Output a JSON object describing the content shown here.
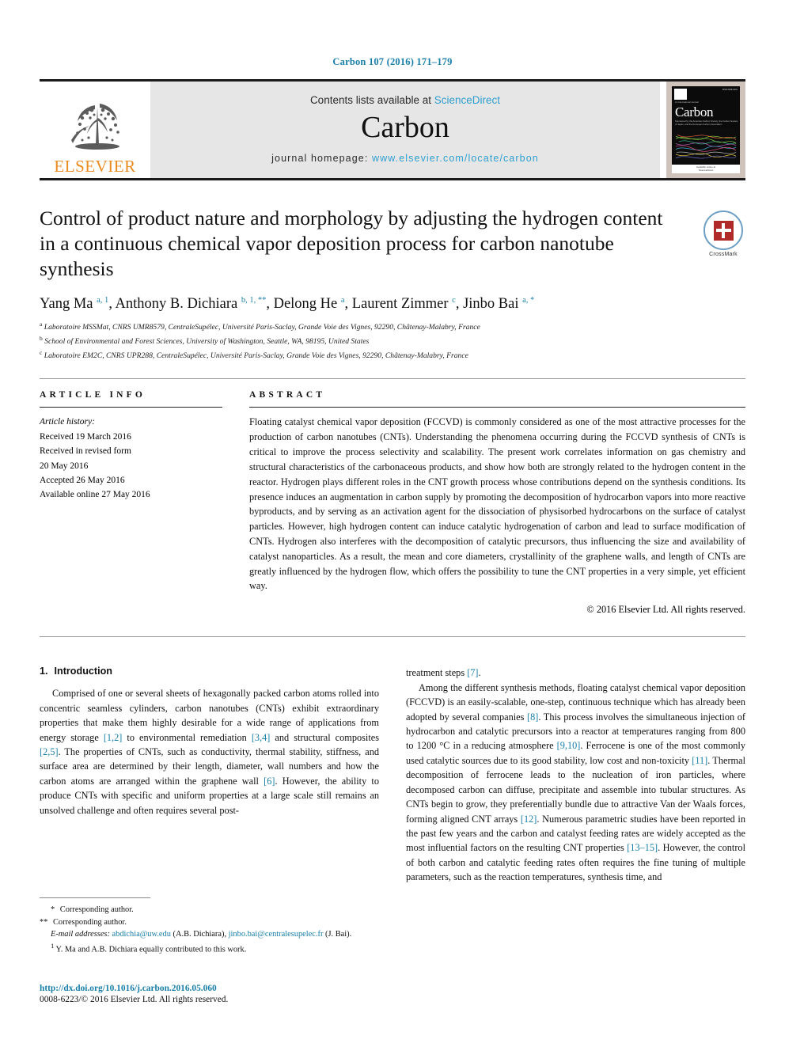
{
  "running_head": "Carbon 107 (2016) 171–179",
  "masthead": {
    "publisher_name": "ELSEVIER",
    "publisher_logo_icon": "elsevier-tree-icon",
    "contents_prefix": "Contents lists available at ",
    "contents_link": "ScienceDirect",
    "journal_name": "Carbon",
    "homepage_prefix": "journal homepage: ",
    "homepage_url": "www.elsevier.com/locate/carbon",
    "cover": {
      "title": "Carbon",
      "supertitle": "An International Journal",
      "subtitle": "Sponsored by the American Carbon Society, the Carbon Society of Japan, and the European Carbon Association",
      "footer_line1": "Available online at",
      "footer_line2": "ScienceDirect",
      "issn": "ISSN 0008-6223"
    }
  },
  "article": {
    "title": "Control of product nature and morphology by adjusting the hydrogen content in a continuous chemical vapor deposition process for carbon nanotube synthesis",
    "crossmark_label": "CrossMark",
    "authors_html": "Yang Ma <sup>a, 1</sup>, Anthony B. Dichiara <sup>b, 1, **</sup>, Delong He <sup>a</sup>, Laurent Zimmer <sup>c</sup>, Jinbo Bai <sup>a, *</sup>",
    "affiliations": [
      {
        "marker": "a",
        "text": "Laboratoire MSSMat, CNRS UMR8579, CentraleSupélec, Université Paris-Saclay, Grande Voie des Vignes, 92290, Châtenay-Malabry, France"
      },
      {
        "marker": "b",
        "text": "School of Environmental and Forest Sciences, University of Washington, Seattle, WA, 98195, United States"
      },
      {
        "marker": "c",
        "text": "Laboratoire EM2C, CNRS UPR288, CentraleSupélec, Université Paris-Saclay, Grande Voie des Vignes, 92290, Châtenay-Malabry, France"
      }
    ]
  },
  "article_info": {
    "heading": "ARTICLE INFO",
    "history_label": "Article history:",
    "history": [
      "Received 19 March 2016",
      "Received in revised form",
      "20 May 2016",
      "Accepted 26 May 2016",
      "Available online 27 May 2016"
    ]
  },
  "abstract": {
    "heading": "ABSTRACT",
    "body": "Floating catalyst chemical vapor deposition (FCCVD) is commonly considered as one of the most attractive processes for the production of carbon nanotubes (CNTs). Understanding the phenomena occurring during the FCCVD synthesis of CNTs is critical to improve the process selectivity and scalability. The present work correlates information on gas chemistry and structural characteristics of the carbonaceous products, and show how both are strongly related to the hydrogen content in the reactor. Hydrogen plays different roles in the CNT growth process whose contributions depend on the synthesis conditions. Its presence induces an augmentation in carbon supply by promoting the decomposition of hydrocarbon vapors into more reactive byproducts, and by serving as an activation agent for the dissociation of physisorbed hydrocarbons on the surface of catalyst particles. However, high hydrogen content can induce catalytic hydrogenation of carbon and lead to surface modification of CNTs. Hydrogen also interferes with the decomposition of catalytic precursors, thus influencing the size and availability of catalyst nanoparticles. As a result, the mean and core diameters, crystallinity of the graphene walls, and length of CNTs are greatly influenced by the hydrogen flow, which offers the possibility to tune the CNT properties in a very simple, yet efficient way.",
    "copyright": "© 2016 Elsevier Ltd. All rights reserved."
  },
  "body": {
    "section_number": "1.",
    "section_title": "Introduction",
    "left_column_html": "Comprised of one or several sheets of hexagonally packed carbon atoms rolled into concentric seamless cylinders, carbon nanotubes (CNTs) exhibit extraordinary properties that make them highly desirable for a wide range of applications from energy storage <span class=\"ref\">[1,2]</span> to environmental remediation <span class=\"ref\">[3,4]</span> and structural composites <span class=\"ref\">[2,5]</span>. The properties of CNTs, such as conductivity, thermal stability, stiffness, and surface area are determined by their length, diameter, wall numbers and how the carbon atoms are arranged within the graphene wall <span class=\"ref\">[6]</span>. However, the ability to produce CNTs with specific and uniform properties at a large scale still remains an unsolved challenge and often requires several post-",
    "right_column_first_html": "treatment steps <span class=\"ref\">[7]</span>.",
    "right_column_html": "Among the different synthesis methods, floating catalyst chemical vapor deposition (FCCVD) is an easily-scalable, one-step, continuous technique which has already been adopted by several companies <span class=\"ref\">[8]</span>. This process involves the simultaneous injection of hydrocarbon and catalytic precursors into a reactor at temperatures ranging from 800 to 1200 °C in a reducing atmosphere <span class=\"ref\">[9,10]</span>. Ferrocene is one of the most commonly used catalytic sources due to its good stability, low cost and non-toxicity <span class=\"ref\">[11]</span>. Thermal decomposition of ferrocene leads to the nucleation of iron particles, where decomposed carbon can diffuse, precipitate and assemble into tubular structures. As CNTs begin to grow, they preferentially bundle due to attractive Van der Waals forces, forming aligned CNT arrays <span class=\"ref\">[12]</span>. Numerous parametric studies have been reported in the past few years and the carbon and catalyst feeding rates are widely accepted as the most influential factors on the resulting CNT properties <span class=\"ref\">[13–15]</span>. However, the control of both carbon and catalytic feeding rates often requires the fine tuning of multiple parameters, such as the reaction temperatures, synthesis time, and"
  },
  "footnotes": {
    "line1_html": "<span class=\"star\">*</span> Corresponding author.",
    "line2_html": "<span class=\"star\">**</span> Corresponding author.",
    "emails_html": "<i>E-mail addresses:</i> <span class=\"link\">abdichia@uw.edu</span> (A.B. Dichiara), <span class=\"link\">jinbo.bai@centralesupelec.fr</span> (J. Bai).",
    "equal_contrib_html": "<sup>1</sup> Y. Ma and A.B. Dichiara equally contributed to this work."
  },
  "doi": {
    "url": "http://dx.doi.org/10.1016/j.carbon.2016.05.060",
    "copyright": "0008-6223/© 2016 Elsevier Ltd. All rights reserved."
  },
  "colors": {
    "link": "#1a7fa8",
    "sciencedirect": "#2f9fd0",
    "elsevier_orange": "#ea8b1f",
    "band_gray": "#e6e6e6"
  }
}
